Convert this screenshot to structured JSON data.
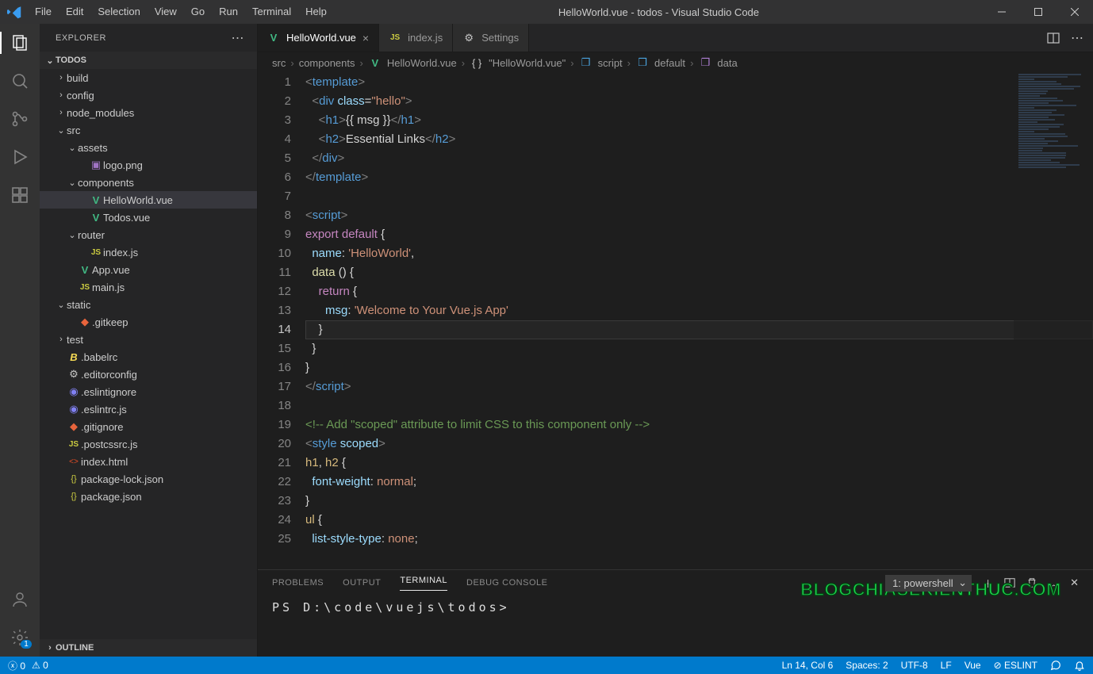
{
  "window": {
    "title": "HelloWorld.vue - todos - Visual Studio Code"
  },
  "menus": [
    "File",
    "Edit",
    "Selection",
    "View",
    "Go",
    "Run",
    "Terminal",
    "Help"
  ],
  "explorer": {
    "title": "EXPLORER",
    "root": "TODOS",
    "outline": "OUTLINE",
    "tree": [
      {
        "d": 1,
        "t": "folder",
        "open": false,
        "label": "build"
      },
      {
        "d": 1,
        "t": "folder",
        "open": false,
        "label": "config"
      },
      {
        "d": 1,
        "t": "folder",
        "open": false,
        "label": "node_modules"
      },
      {
        "d": 1,
        "t": "folder",
        "open": true,
        "label": "src"
      },
      {
        "d": 2,
        "t": "folder",
        "open": true,
        "label": "assets"
      },
      {
        "d": 3,
        "t": "file",
        "icon": "image",
        "label": "logo.png"
      },
      {
        "d": 2,
        "t": "folder",
        "open": true,
        "label": "components"
      },
      {
        "d": 3,
        "t": "file",
        "icon": "vue",
        "label": "HelloWorld.vue",
        "selected": true
      },
      {
        "d": 3,
        "t": "file",
        "icon": "vue",
        "label": "Todos.vue"
      },
      {
        "d": 2,
        "t": "folder",
        "open": true,
        "label": "router"
      },
      {
        "d": 3,
        "t": "file",
        "icon": "js",
        "label": "index.js"
      },
      {
        "d": 2,
        "t": "file",
        "icon": "vue",
        "label": "App.vue"
      },
      {
        "d": 2,
        "t": "file",
        "icon": "js",
        "label": "main.js"
      },
      {
        "d": 1,
        "t": "folder",
        "open": true,
        "label": "static"
      },
      {
        "d": 2,
        "t": "file",
        "icon": "git",
        "label": ".gitkeep"
      },
      {
        "d": 1,
        "t": "folder",
        "open": false,
        "label": "test"
      },
      {
        "d": 1,
        "t": "file",
        "icon": "babel",
        "label": ".babelrc"
      },
      {
        "d": 1,
        "t": "file",
        "icon": "config",
        "label": ".editorconfig"
      },
      {
        "d": 1,
        "t": "file",
        "icon": "eslint",
        "label": ".eslintignore"
      },
      {
        "d": 1,
        "t": "file",
        "icon": "eslint",
        "label": ".eslintrc.js"
      },
      {
        "d": 1,
        "t": "file",
        "icon": "git",
        "label": ".gitignore"
      },
      {
        "d": 1,
        "t": "file",
        "icon": "js",
        "label": ".postcssrc.js"
      },
      {
        "d": 1,
        "t": "file",
        "icon": "html",
        "label": "index.html"
      },
      {
        "d": 1,
        "t": "file",
        "icon": "json",
        "label": "package-lock.json"
      },
      {
        "d": 1,
        "t": "file",
        "icon": "json",
        "label": "package.json"
      }
    ]
  },
  "tabs": [
    {
      "icon": "vue",
      "label": "HelloWorld.vue",
      "active": true,
      "closeable": true
    },
    {
      "icon": "js",
      "label": "index.js",
      "active": false,
      "closeable": false
    },
    {
      "icon": "gear",
      "label": "Settings",
      "active": false,
      "closeable": false
    }
  ],
  "breadcrumbs": [
    {
      "icon": "",
      "label": "src"
    },
    {
      "icon": "",
      "label": "components"
    },
    {
      "icon": "vue",
      "label": "HelloWorld.vue"
    },
    {
      "icon": "braces",
      "label": "\"HelloWorld.vue\""
    },
    {
      "icon": "cube-blue",
      "label": "script"
    },
    {
      "icon": "cube-blue",
      "label": "default"
    },
    {
      "icon": "cube-purple",
      "label": "data"
    }
  ],
  "code": {
    "current_line": 14,
    "lines": [
      {
        "n": 1,
        "h": "<span class='t-gray'>&lt;</span><span class='t-tag'>template</span><span class='t-gray'>&gt;</span>"
      },
      {
        "n": 2,
        "h": "  <span class='t-gray'>&lt;</span><span class='t-tag'>div</span> <span class='t-attr'>class</span><span class='t-plain'>=</span><span class='t-str'>\"hello\"</span><span class='t-gray'>&gt;</span>"
      },
      {
        "n": 3,
        "h": "    <span class='t-gray'>&lt;</span><span class='t-tag'>h1</span><span class='t-gray'>&gt;</span><span class='t-plain'>{{ msg }}</span><span class='t-gray'>&lt;/</span><span class='t-tag'>h1</span><span class='t-gray'>&gt;</span>"
      },
      {
        "n": 4,
        "h": "    <span class='t-gray'>&lt;</span><span class='t-tag'>h2</span><span class='t-gray'>&gt;</span><span class='t-plain'>Essential Links</span><span class='t-gray'>&lt;/</span><span class='t-tag'>h2</span><span class='t-gray'>&gt;</span>"
      },
      {
        "n": 5,
        "h": "  <span class='t-gray'>&lt;/</span><span class='t-tag'>div</span><span class='t-gray'>&gt;</span>"
      },
      {
        "n": 6,
        "h": "<span class='t-gray'>&lt;/</span><span class='t-tag'>template</span><span class='t-gray'>&gt;</span>"
      },
      {
        "n": 7,
        "h": ""
      },
      {
        "n": 8,
        "h": "<span class='t-gray'>&lt;</span><span class='t-tag'>script</span><span class='t-gray'>&gt;</span>"
      },
      {
        "n": 9,
        "h": "<span class='t-kw'>export</span> <span class='t-kw'>default</span> <span class='t-plain'>{</span>"
      },
      {
        "n": 10,
        "h": "  <span class='t-id'>name</span><span class='t-plain'>:</span> <span class='t-str'>'HelloWorld'</span><span class='t-plain'>,</span>"
      },
      {
        "n": 11,
        "h": "  <span class='t-fn'>data</span> <span class='t-plain'>() {</span>"
      },
      {
        "n": 12,
        "h": "    <span class='t-kw'>return</span> <span class='t-plain'>{</span>"
      },
      {
        "n": 13,
        "h": "      <span class='t-id'>msg</span><span class='t-plain'>:</span> <span class='t-str'>'Welcome to Your Vue.js App'</span>"
      },
      {
        "n": 14,
        "h": "    <span class='t-plain'>}</span>"
      },
      {
        "n": 15,
        "h": "  <span class='t-plain'>}</span>"
      },
      {
        "n": 16,
        "h": "<span class='t-plain'>}</span>"
      },
      {
        "n": 17,
        "h": "<span class='t-gray'>&lt;/</span><span class='t-tag'>script</span><span class='t-gray'>&gt;</span>"
      },
      {
        "n": 18,
        "h": ""
      },
      {
        "n": 19,
        "h": "<span class='t-cmt'>&lt;!-- Add \"scoped\" attribute to limit CSS to this component only --&gt;</span>"
      },
      {
        "n": 20,
        "h": "<span class='t-gray'>&lt;</span><span class='t-tag'>style</span> <span class='t-attr'>scoped</span><span class='t-gray'>&gt;</span>"
      },
      {
        "n": 21,
        "h": "<span class='t-sel'>h1</span><span class='t-plain'>,</span> <span class='t-sel'>h2</span> <span class='t-plain'>{</span>"
      },
      {
        "n": 22,
        "h": "  <span class='t-prop'>font-weight</span><span class='t-plain'>:</span> <span class='t-val'>normal</span><span class='t-plain'>;</span>"
      },
      {
        "n": 23,
        "h": "<span class='t-plain'>}</span>"
      },
      {
        "n": 24,
        "h": "<span class='t-sel'>ul</span> <span class='t-plain'>{</span>"
      },
      {
        "n": 25,
        "h": "  <span class='t-prop'>list-style-type</span><span class='t-plain'>:</span> <span class='t-val'>none</span><span class='t-plain'>;</span>"
      }
    ]
  },
  "panel": {
    "tabs": [
      "PROBLEMS",
      "OUTPUT",
      "TERMINAL",
      "DEBUG CONSOLE"
    ],
    "active": 2,
    "term_select": "1: powershell",
    "prompt": "PS D:\\code\\vuejs\\todos>"
  },
  "status": {
    "errors": "0",
    "warnings": "0",
    "position": "Ln 14, Col 6",
    "spaces": "Spaces: 2",
    "encoding": "UTF-8",
    "eol": "LF",
    "language": "Vue",
    "eslint": "ESLINT"
  },
  "watermark": "BLOGCHIASEKIENTHUC.COM",
  "icons": {
    "vue": {
      "glyph": "V",
      "color": "#41b883",
      "weight": "700"
    },
    "js": {
      "glyph": "JS",
      "color": "#cbcb41",
      "weight": "700",
      "size": "10px"
    },
    "image": {
      "glyph": "▣",
      "color": "#a074c4"
    },
    "git": {
      "glyph": "◆",
      "color": "#e8643c"
    },
    "babel": {
      "glyph": "B",
      "color": "#f5da55",
      "style": "italic",
      "weight": "700"
    },
    "config": {
      "glyph": "⚙",
      "color": "#c5c5c5"
    },
    "eslint": {
      "glyph": "◉",
      "color": "#8080f2"
    },
    "html": {
      "glyph": "<>",
      "color": "#e44d26",
      "size": "10px"
    },
    "json": {
      "glyph": "{}",
      "color": "#cbcb41",
      "size": "11px"
    },
    "gear": {
      "glyph": "⚙",
      "color": "#c5c5c5"
    },
    "braces": {
      "glyph": "{ }",
      "color": "#c5c5c5"
    },
    "cube-blue": {
      "glyph": "❒",
      "color": "#4aa3df"
    },
    "cube-purple": {
      "glyph": "❒",
      "color": "#b180d7"
    }
  }
}
